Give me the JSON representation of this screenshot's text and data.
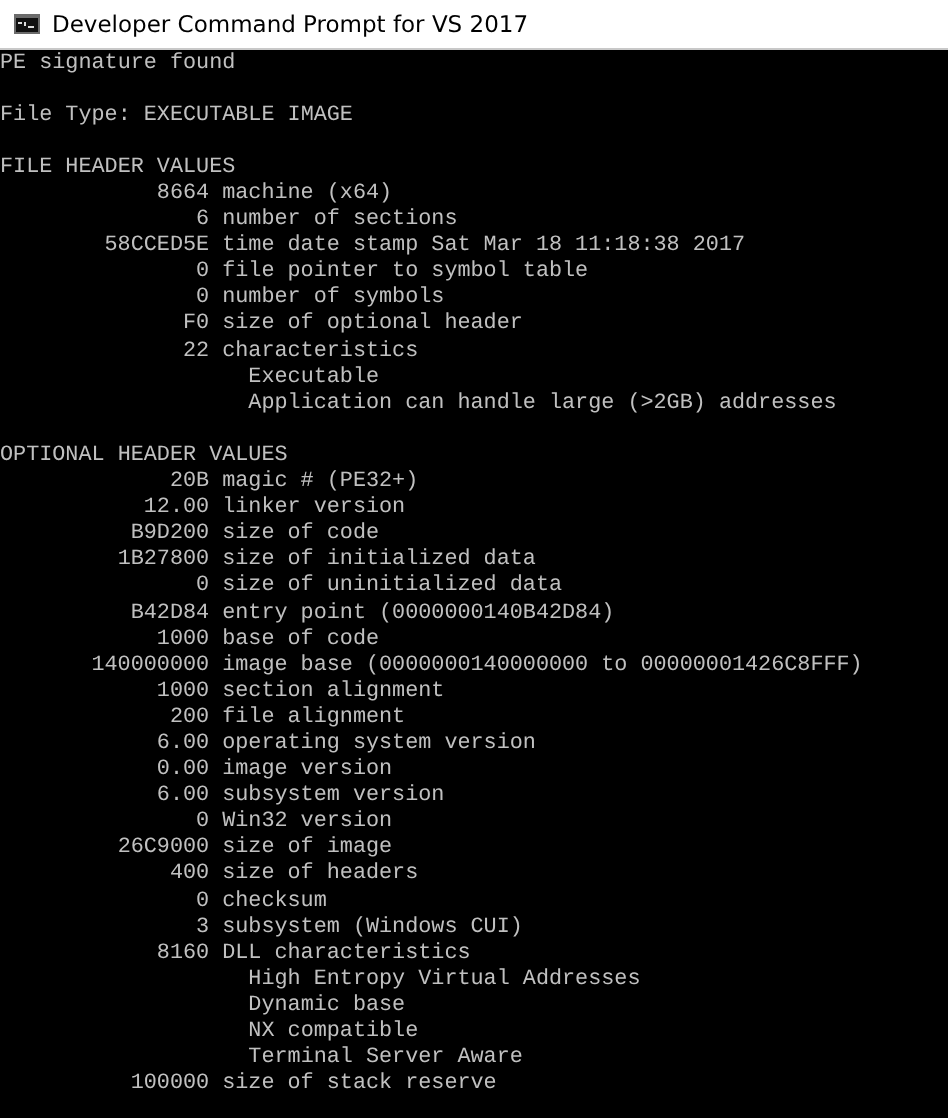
{
  "window": {
    "title": "Developer Command Prompt for VS 2017"
  },
  "console": {
    "blocks": [
      {
        "lines": [
          {
            "kind": "text",
            "text": "PE signature found"
          }
        ]
      },
      {
        "lines": [
          {
            "kind": "text",
            "text": "File Type: EXECUTABLE IMAGE"
          }
        ]
      },
      {
        "lines": [
          {
            "kind": "text",
            "text": "FILE HEADER VALUES"
          },
          {
            "kind": "field",
            "number": "8664",
            "description": "machine (x64)"
          },
          {
            "kind": "field",
            "number": "6",
            "description": "number of sections"
          },
          {
            "kind": "field",
            "number": "58CCED5E",
            "description": "time date stamp Sat Mar 18 11:18:38 2017"
          },
          {
            "kind": "field",
            "number": "0",
            "description": "file pointer to symbol table"
          },
          {
            "kind": "field",
            "number": "0",
            "description": "number of symbols"
          },
          {
            "kind": "field",
            "number": "F0",
            "description": "size of optional header"
          },
          {
            "kind": "field",
            "number": "22",
            "description": "characteristics"
          },
          {
            "kind": "detail",
            "text": "Executable"
          },
          {
            "kind": "detail",
            "text": "Application can handle large (>2GB) addresses"
          }
        ]
      },
      {
        "lines": [
          {
            "kind": "text",
            "text": "OPTIONAL HEADER VALUES"
          },
          {
            "kind": "field",
            "number": "20B",
            "description": "magic # (PE32+)"
          },
          {
            "kind": "field",
            "number": "12.00",
            "description": "linker version"
          },
          {
            "kind": "field",
            "number": "B9D200",
            "description": "size of code"
          },
          {
            "kind": "field",
            "number": "1B27800",
            "description": "size of initialized data"
          },
          {
            "kind": "field",
            "number": "0",
            "description": "size of uninitialized data"
          },
          {
            "kind": "field",
            "number": "B42D84",
            "description": "entry point (0000000140B42D84)"
          },
          {
            "kind": "field",
            "number": "1000",
            "description": "base of code"
          },
          {
            "kind": "field",
            "number": "140000000",
            "description": "image base (0000000140000000 to 00000001426C8FFF)"
          },
          {
            "kind": "field",
            "number": "1000",
            "description": "section alignment"
          },
          {
            "kind": "field",
            "number": "200",
            "description": "file alignment"
          },
          {
            "kind": "field",
            "number": "6.00",
            "description": "operating system version"
          },
          {
            "kind": "field",
            "number": "0.00",
            "description": "image version"
          },
          {
            "kind": "field",
            "number": "6.00",
            "description": "subsystem version"
          },
          {
            "kind": "field",
            "number": "0",
            "description": "Win32 version"
          },
          {
            "kind": "field",
            "number": "26C9000",
            "description": "size of image"
          },
          {
            "kind": "field",
            "number": "400",
            "description": "size of headers"
          },
          {
            "kind": "field",
            "number": "0",
            "description": "checksum"
          },
          {
            "kind": "field",
            "number": "3",
            "description": "subsystem (Windows CUI)"
          },
          {
            "kind": "field",
            "number": "8160",
            "description": "DLL characteristics"
          },
          {
            "kind": "detail",
            "text": "High Entropy Virtual Addresses"
          },
          {
            "kind": "detail",
            "text": "Dynamic base"
          },
          {
            "kind": "detail",
            "text": "NX compatible"
          },
          {
            "kind": "detail",
            "text": "Terminal Server Aware"
          },
          {
            "kind": "field",
            "number": "100000",
            "description": "size of stack reserve"
          }
        ]
      }
    ]
  }
}
